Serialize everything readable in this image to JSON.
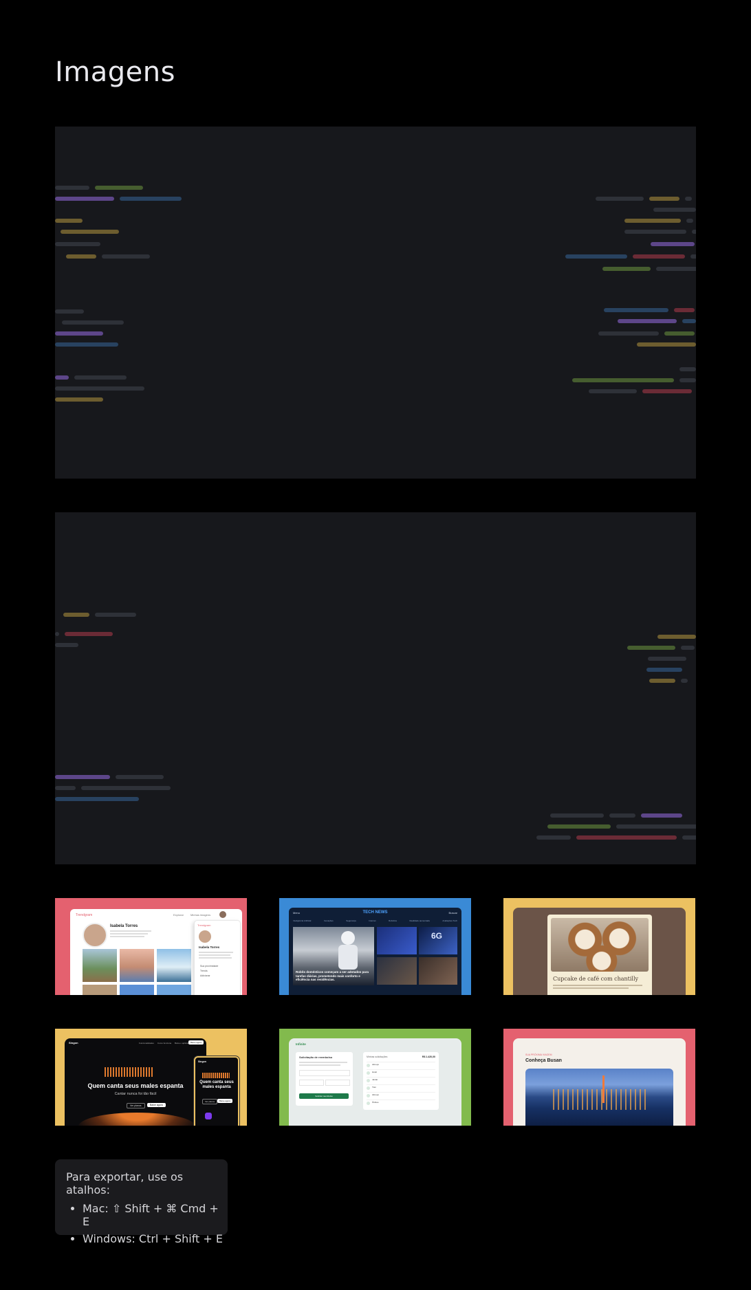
{
  "page": {
    "title": "Imagens"
  },
  "colors": {
    "background": "#000000",
    "image_placeholder": "#17181c",
    "thumb_pink": "#e4616f",
    "thumb_blue": "#3a8ad6",
    "thumb_yellow": "#ecc161",
    "thumb_green": "#82ba4d"
  },
  "placeholder_bar_colors": [
    "#33363d",
    "#6a4f9c",
    "#2c4a6c",
    "#7c6a33",
    "#4f6a32",
    "#7a2f3b"
  ],
  "thumbnails": [
    {
      "label": "Trendgram",
      "name": "Isabela Torres",
      "search": "Explorar",
      "menu": "Minhas imagens",
      "side_links": [
        "Sua proximidade",
        "Trends",
        "Adicionar"
      ]
    },
    {
      "label": "TECH NEWS",
      "menu": "Menu",
      "search": "Buscar",
      "nav": [
        "Inteligência Artificial",
        "Inovações",
        "Segurança",
        "Internet",
        "Robótica",
        "Realidade aumentada",
        "Avaliações Tech"
      ],
      "headline": "Robôs domésticos começam a ser adotados para tarefas diárias, prometendo mais conforto e eficiência nas residências.",
      "badge": "6G"
    },
    {
      "recipe_title": "Cupcake de café com chantilly"
    },
    {
      "label": "Singon",
      "cta": "Baixe agora",
      "headline": "Quem canta seus males espanta",
      "subline": "Cantar nunca foi tão fácil",
      "btn_secondary": "Ver planos",
      "nav": [
        "Funcionalidades",
        "Como funciona",
        "Baixe o aplicativo"
      ],
      "mobile_headline": "Quem canta seus males espanta"
    },
    {
      "label": "Infinite",
      "form_title": "Solicitação de reembolso",
      "form_button": "Solicitar reembolso",
      "list_title": "Minhas solicitações",
      "total": "R$ 1.420,00",
      "items": [
        "Almoço",
        "Hotel",
        "Jantar",
        "Táxi",
        "Almoço",
        "Ônibus"
      ]
    },
    {
      "kicker": "SUA PRÓXIMA VIAGEM",
      "title": "Conheça Busan"
    }
  ],
  "help": {
    "lead": "Para exportar, use os atalhos:",
    "shortcuts": [
      "Mac: ⇧ Shift + ⌘ Cmd + E",
      "Windows: Ctrl + Shift + E"
    ]
  }
}
